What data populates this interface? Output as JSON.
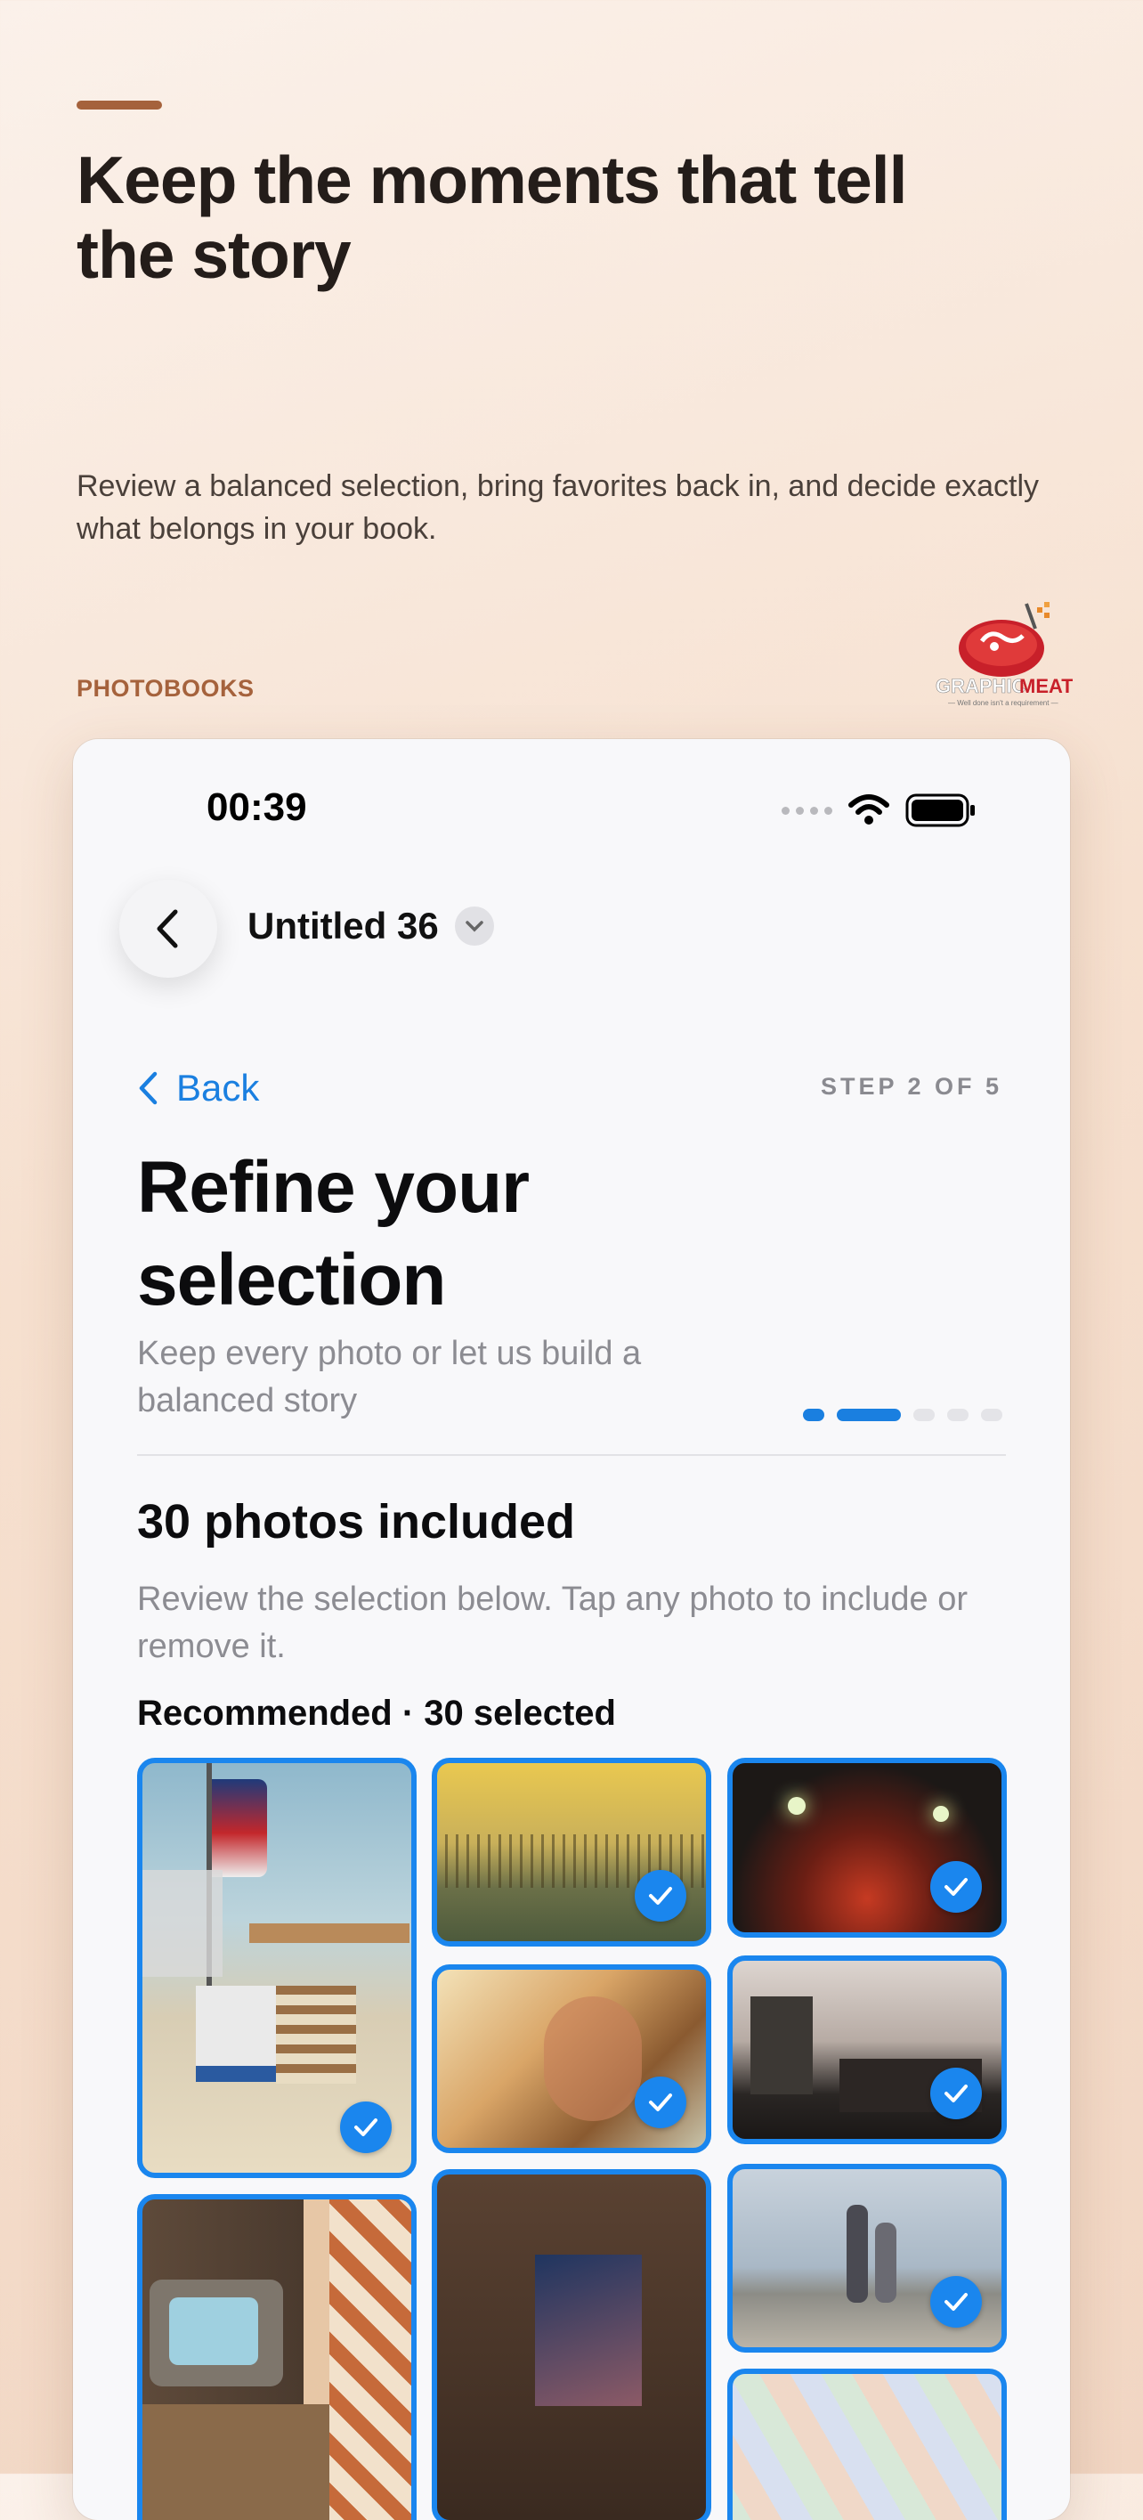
{
  "hero": {
    "title": "Keep the moments that tell the story",
    "subtitle": "Review a balanced selection, bring favorites back in, and decide exactly what belongs in your book.",
    "category": "PHOTOBOOKS"
  },
  "logo": {
    "brand_text": "GRAPHICMEAT",
    "tagline": "Well done isn't a requirement"
  },
  "status_bar": {
    "time": "00:39"
  },
  "nav": {
    "document_title": "Untitled 36"
  },
  "header": {
    "back_label": "Back",
    "step_label": "STEP 2 OF 5"
  },
  "page": {
    "title": "Refine your selection",
    "subtitle": "Keep every photo or let us build a balanced story"
  },
  "progress": {
    "current_step": 2,
    "total_steps": 5
  },
  "section": {
    "title": "30 photos included",
    "description": "Review the selection below. Tap any photo to include or remove it.",
    "selection_label": "Recommended · 30 selected"
  },
  "photos": [
    {
      "subject": "beach lifeguard hut with flag",
      "selected": true
    },
    {
      "subject": "sunset grass field",
      "selected": true
    },
    {
      "subject": "people at night cafe",
      "selected": true
    },
    {
      "subject": "smiling girl with windblown hair",
      "selected": true
    },
    {
      "subject": "cafe storefront on street",
      "selected": true
    },
    {
      "subject": "retro television in room",
      "selected": true
    },
    {
      "subject": "poster in dim room",
      "selected": true
    },
    {
      "subject": "people on pebble beach",
      "selected": true
    },
    {
      "subject": "colorful geometric pattern",
      "selected": true
    }
  ],
  "colors": {
    "accent": "#1a86ee",
    "brand": "#a5623c"
  }
}
